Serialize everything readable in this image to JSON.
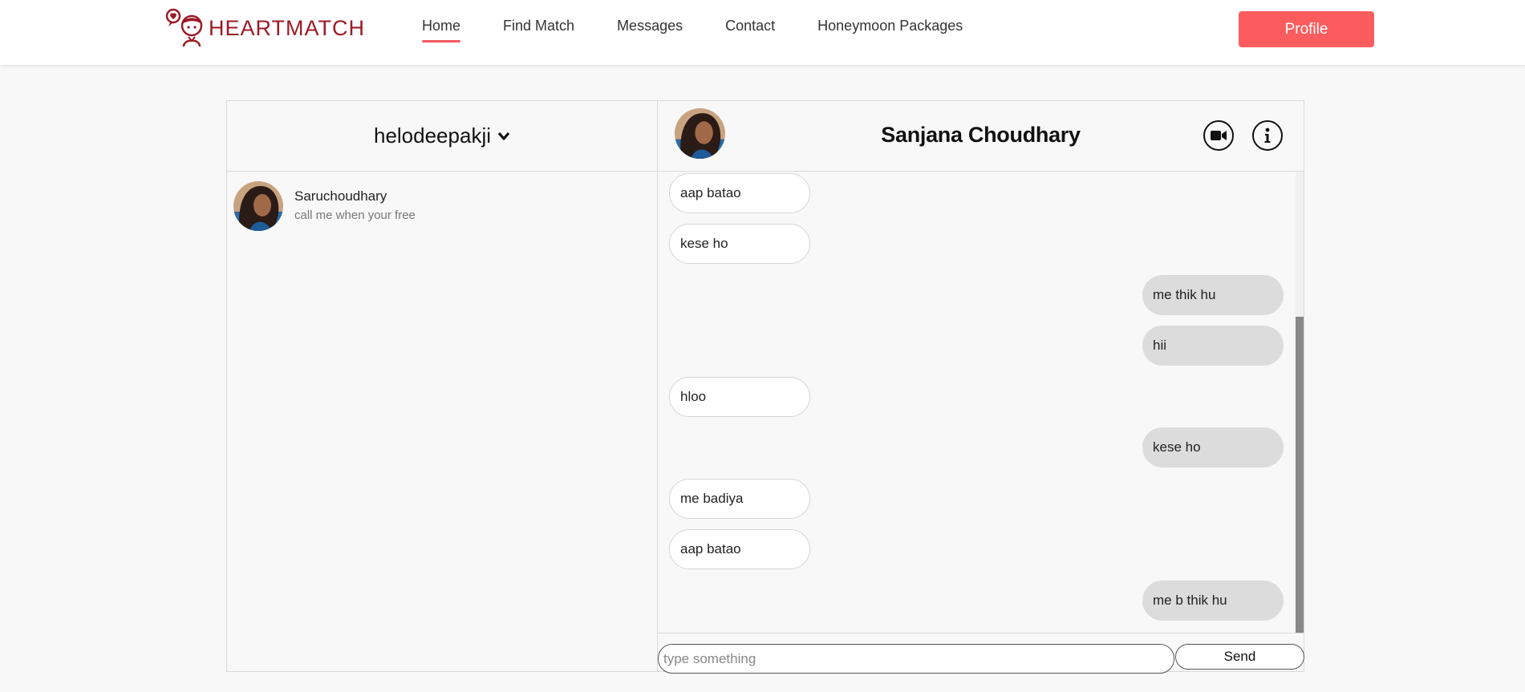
{
  "brand": {
    "name": "HEARTMATCH",
    "logo_icon": "heart-bubble-boy-icon",
    "color": "#9b1b26"
  },
  "nav": {
    "items": [
      {
        "label": "Home",
        "active": true
      },
      {
        "label": "Find Match",
        "active": false
      },
      {
        "label": "Messages",
        "active": false
      },
      {
        "label": "Contact",
        "active": false
      },
      {
        "label": "Honeymoon Packages",
        "active": false
      }
    ],
    "profile_label": "Profile",
    "accent": "#fd5c5e"
  },
  "sidebar": {
    "username": "helodeepakji",
    "conversations": [
      {
        "name": "Saruchoudhary",
        "last_message": "call me when your free"
      }
    ]
  },
  "chat": {
    "title": "Sanjana Choudhary",
    "video_icon": "video-camera-icon",
    "info_icon": "info-icon",
    "messages": [
      {
        "text": "aap batao",
        "direction": "incoming"
      },
      {
        "text": "kese ho",
        "direction": "incoming"
      },
      {
        "text": "me thik hu",
        "direction": "outgoing"
      },
      {
        "text": "hii",
        "direction": "outgoing"
      },
      {
        "text": "hloo",
        "direction": "incoming"
      },
      {
        "text": "kese ho",
        "direction": "outgoing"
      },
      {
        "text": "me badiya",
        "direction": "incoming"
      },
      {
        "text": "aap batao",
        "direction": "incoming"
      },
      {
        "text": "me b thik hu",
        "direction": "outgoing"
      }
    ],
    "input_placeholder": "type something",
    "send_label": "Send"
  }
}
